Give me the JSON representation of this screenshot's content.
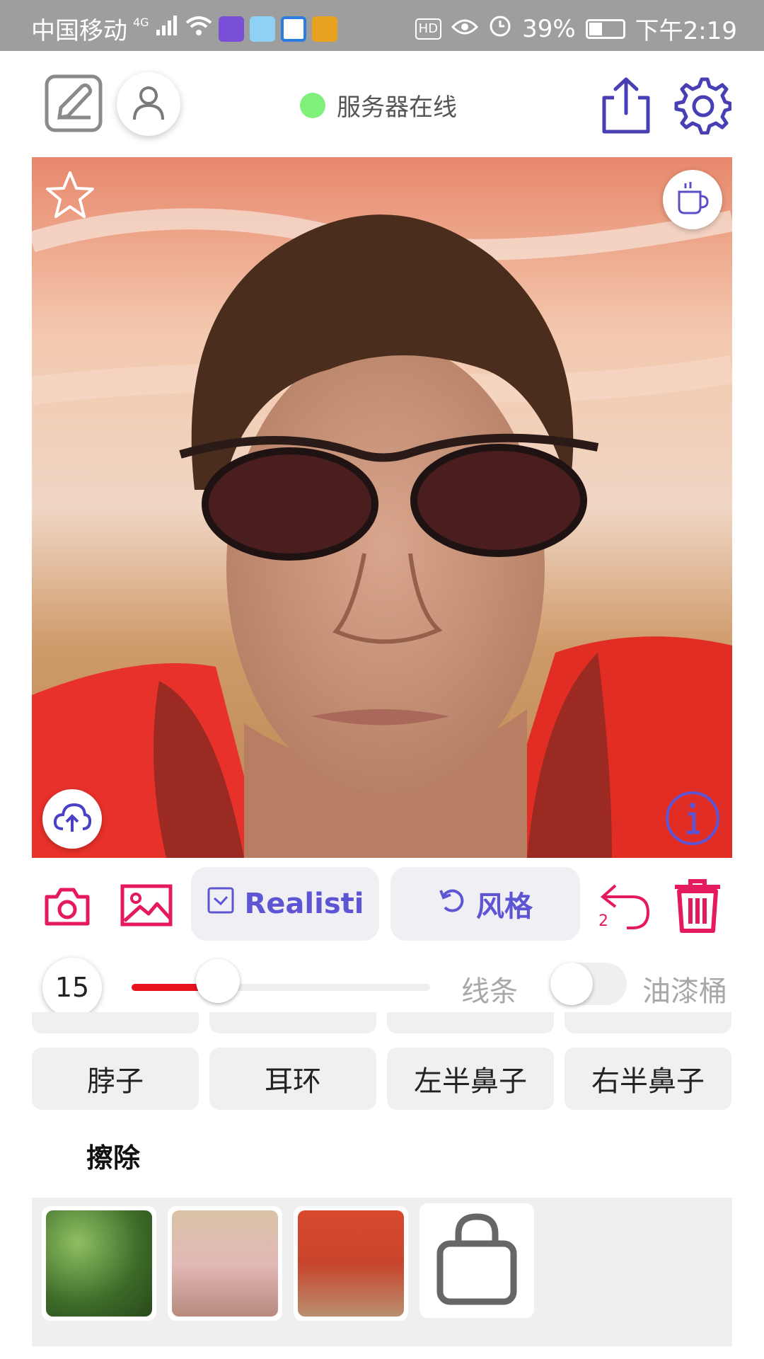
{
  "status_bar": {
    "carrier": "中国移动",
    "network": "4G",
    "battery_percent": "39%",
    "time": "下午2:19",
    "hd": "HD",
    "battery_level": 0.39,
    "app_icons": [
      "tieba-app-icon",
      "rabbit-app-icon",
      "browser-app-icon",
      "game-app-icon"
    ]
  },
  "header": {
    "server_status": "服务器在线",
    "server_status_color": "#7ff07a",
    "icons": [
      "edit-icon",
      "user-icon",
      "share-icon",
      "settings-icon"
    ]
  },
  "canvas": {
    "icons": [
      "star-icon",
      "coffee-cup-icon",
      "cloud-upload-icon",
      "info-icon"
    ]
  },
  "toolbar": {
    "model_label": "Realisti",
    "style_label": "风格",
    "undo_count": "2",
    "accent_color": "#e5195e",
    "pill_text_color": "#5e55d4"
  },
  "brush": {
    "size": "15",
    "size_fraction": 0.29,
    "line_label": "线条",
    "bucket_label": "油漆桶",
    "bucket_enabled": false
  },
  "parts": [
    {
      "label": "脖子"
    },
    {
      "label": "耳环"
    },
    {
      "label": "左半鼻子"
    },
    {
      "label": "右半鼻子"
    }
  ],
  "erase_label": "擦除",
  "textures": [
    {
      "name": "green-foliage-texture",
      "color": "#4e7a35"
    },
    {
      "name": "pink-blossom-texture",
      "color": "#d9b9a4"
    },
    {
      "name": "red-flower-texture",
      "color": "#c8442c"
    },
    {
      "name": "shop-bag-icon",
      "color": "#ffffff"
    }
  ]
}
